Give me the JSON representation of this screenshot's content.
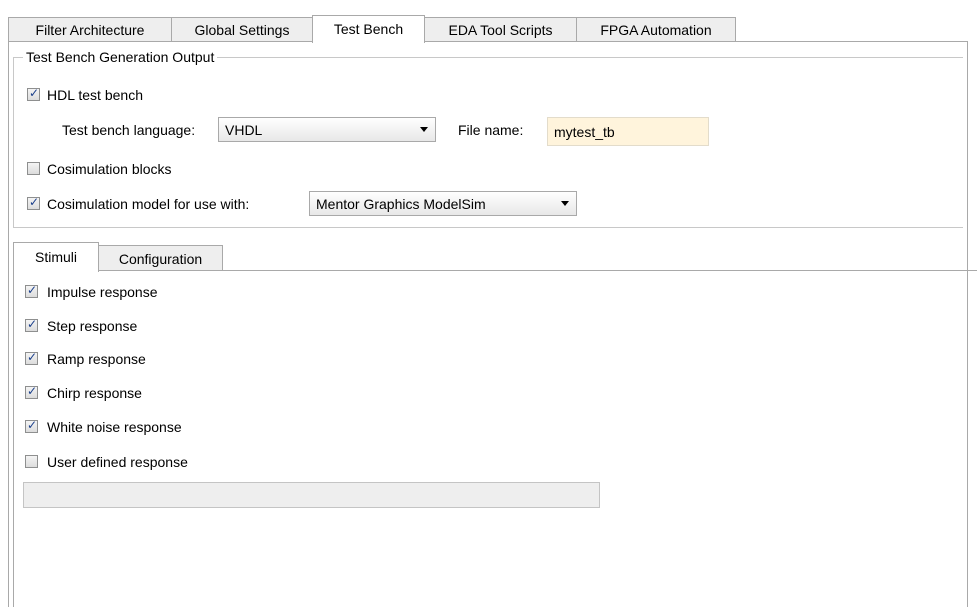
{
  "top_tabs": [
    {
      "label": "Filter Architecture",
      "active": false
    },
    {
      "label": "Global Settings",
      "active": false
    },
    {
      "label": "Test Bench",
      "active": true
    },
    {
      "label": "EDA Tool Scripts",
      "active": false
    },
    {
      "label": "FPGA Automation",
      "active": false
    }
  ],
  "output_group": {
    "title": "Test Bench Generation Output",
    "hdl_test_bench": {
      "label": "HDL test bench",
      "checked": true
    },
    "language_label": "Test bench language:",
    "language_value": "VHDL",
    "file_name_label": "File name:",
    "file_name_value": "mytest_tb",
    "cosim_blocks": {
      "label": "Cosimulation blocks",
      "checked": false
    },
    "cosim_model": {
      "label": "Cosimulation model for use with:",
      "checked": true
    },
    "cosim_tool_value": "Mentor Graphics ModelSim"
  },
  "inner_tabs": [
    {
      "label": "Stimuli",
      "active": true
    },
    {
      "label": "Configuration",
      "active": false
    }
  ],
  "stimuli": [
    {
      "label": "Impulse response",
      "checked": true
    },
    {
      "label": "Step response",
      "checked": true
    },
    {
      "label": "Ramp response",
      "checked": true
    },
    {
      "label": "Chirp response",
      "checked": true
    },
    {
      "label": "White noise response",
      "checked": true
    },
    {
      "label": "User defined response",
      "checked": false
    }
  ],
  "user_defined_value": "",
  "colors": {
    "file_field_bg": "#fff4dc",
    "check_color": "#1b3f8b"
  }
}
